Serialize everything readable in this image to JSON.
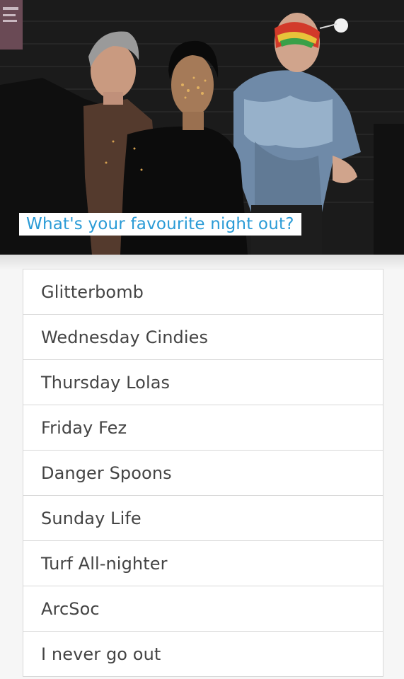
{
  "poll": {
    "question": "What's your favourite night out?",
    "photo": {
      "description_icon": "photo-of-three-people-posing"
    },
    "options": [
      "Glitterbomb",
      "Wednesday Cindies",
      "Thursday Lolas",
      "Friday Fez",
      "Danger Spoons",
      "Sunday Life",
      "Turf All-nighter",
      "ArcSoc",
      "I never go out"
    ]
  },
  "colors": {
    "question_text": "#2a9bd6",
    "option_text": "#444444",
    "border": "#d8d8d8",
    "page_background": "#f6f6f6"
  }
}
